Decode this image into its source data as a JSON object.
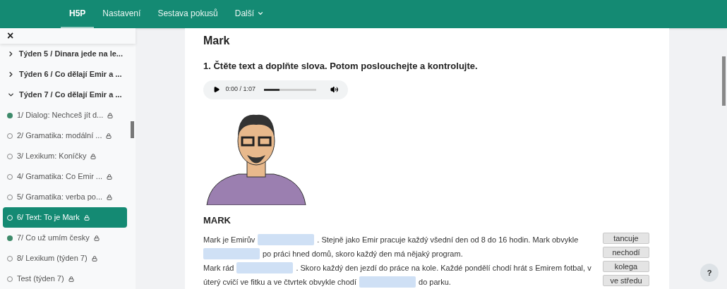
{
  "navbar": {
    "items": [
      {
        "label": "H5P",
        "selected": true,
        "dropdown": false
      },
      {
        "label": "Nastavení",
        "selected": false,
        "dropdown": false
      },
      {
        "label": "Sestava pokusů",
        "selected": false,
        "dropdown": false
      },
      {
        "label": "Další",
        "selected": false,
        "dropdown": true
      }
    ]
  },
  "sidebar": {
    "close": "×",
    "sections": [
      {
        "title": "Týden 5 / Dinara jede na le...",
        "expanded": false
      },
      {
        "title": "Týden 6 / Co dělají Emir a ...",
        "expanded": false
      },
      {
        "title": "Týden 7 / Co dělají Emir a ...",
        "expanded": true,
        "children": [
          {
            "label": "1/ Dialog: Nechceš jít d...",
            "completed": true,
            "selected": false,
            "locked": true
          },
          {
            "label": "2/ Gramatika: modální ...",
            "completed": false,
            "selected": false,
            "locked": true
          },
          {
            "label": "3/ Lexikum: Koníčky",
            "completed": false,
            "selected": false,
            "locked": true
          },
          {
            "label": "4/ Gramatika: Co Emir ...",
            "completed": false,
            "selected": false,
            "locked": true
          },
          {
            "label": "5/ Gramatika: verba po...",
            "completed": false,
            "selected": false,
            "locked": true
          },
          {
            "label": "6/ Text: To je Mark",
            "completed": false,
            "selected": true,
            "locked": true
          },
          {
            "label": "7/ Co už umím česky",
            "completed": true,
            "selected": false,
            "locked": true
          },
          {
            "label": "8/ Lexikum (týden 7)",
            "completed": false,
            "selected": false,
            "locked": true
          },
          {
            "label": "Test (týden 7)",
            "completed": false,
            "selected": false,
            "locked": true
          }
        ]
      }
    ]
  },
  "content": {
    "title": "Mark",
    "instruction": "1. Čtěte text a doplňte slova. Potom poslouchejte a kontrolujte.",
    "audio": {
      "time": "0:00 / 1:07",
      "level": 0.3
    },
    "text_heading": "MARK",
    "lines": [
      [
        {
          "kind": "text",
          "text": "Mark je Emirův"
        },
        {
          "kind": "blank"
        },
        {
          "kind": "text",
          "text": ". Stejně jako Emir pracuje každý všední den od 8 do 16 hodin. Mark obvykle"
        }
      ],
      [
        {
          "kind": "blank"
        },
        {
          "kind": "text",
          "text": "po práci hned domů, skoro každý den má nějaký program."
        }
      ],
      [
        {
          "kind": "text",
          "text": "Mark rád"
        },
        {
          "kind": "blank"
        },
        {
          "kind": "text",
          "text": ". Skoro každý den jezdí do práce na kole. Každé pondělí chodí hrát s Emirem fotbal, v"
        }
      ],
      [
        {
          "kind": "text",
          "text": "úterý cvičí ve fitku a ve čtvrtek obvykle chodí"
        },
        {
          "kind": "blank"
        },
        {
          "kind": "text",
          "text": "do parku."
        }
      ]
    ],
    "word_bank": [
      "tancuje",
      "nechodí",
      "kolega",
      "ve středu"
    ]
  },
  "help_button": "?"
}
